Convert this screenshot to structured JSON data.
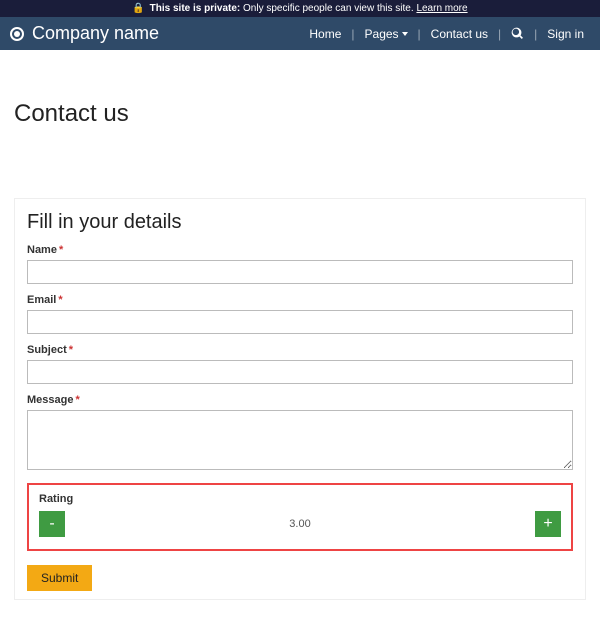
{
  "banner": {
    "prefix": "This site is private:",
    "text": "Only specific people can view this site.",
    "learn": "Learn more"
  },
  "brand": {
    "name": "Company name"
  },
  "nav": {
    "home": "Home",
    "pages": "Pages",
    "contact": "Contact us",
    "signin": "Sign in"
  },
  "page": {
    "title": "Contact us"
  },
  "form": {
    "title": "Fill in your details",
    "name_label": "Name",
    "email_label": "Email",
    "subject_label": "Subject",
    "message_label": "Message",
    "rating_label": "Rating",
    "rating_value": "3.00",
    "minus": "-",
    "plus": "+",
    "submit": "Submit",
    "required": "*"
  }
}
